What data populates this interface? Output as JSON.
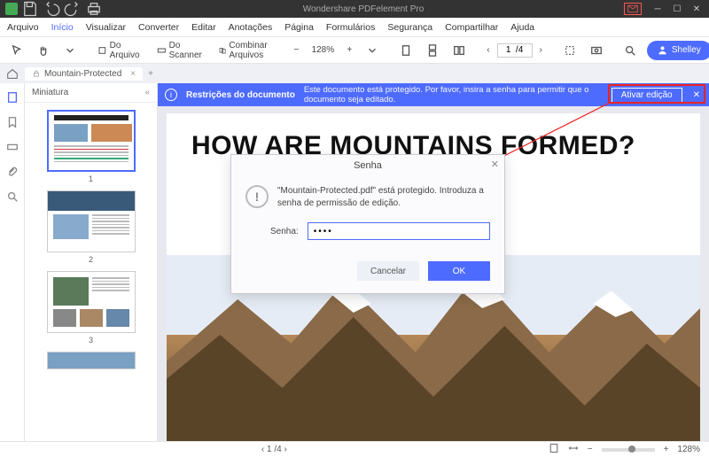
{
  "app": {
    "title": "Wondershare PDFelement Pro"
  },
  "menu": {
    "items": [
      "Arquivo",
      "Início",
      "Visualizar",
      "Converter",
      "Editar",
      "Anotações",
      "Página",
      "Formulários",
      "Segurança",
      "Compartilhar",
      "Ajuda"
    ],
    "active_index": 1
  },
  "toolbar": {
    "file_btn": "Do Arquivo",
    "scanner_btn": "Do Scanner",
    "combine_btn": "Combinar Arquivos",
    "zoom": "128%",
    "page_field": "1  /4",
    "user": "Shelley"
  },
  "tabs": {
    "doc_name": "Mountain-Protected"
  },
  "thumbs": {
    "title": "Miniatura",
    "pages": [
      "1",
      "2",
      "3"
    ]
  },
  "restrict": {
    "title": "Restrições do documento",
    "msg": "Este documento está protegido. Por favor, insira a senha para permitir que o documento seja editado.",
    "btn": "Ativar edição"
  },
  "document": {
    "heading": "HOW ARE MOUNTAINS FORMED?"
  },
  "dialog": {
    "title": "Senha",
    "message": "\"Mountain-Protected.pdf\" está protegido. Introduza a senha de permissão de edição.",
    "label": "Senha:",
    "value": "••••",
    "cancel": "Cancelar",
    "ok": "OK"
  },
  "status": {
    "page": "1 /4",
    "zoom": "128%"
  }
}
